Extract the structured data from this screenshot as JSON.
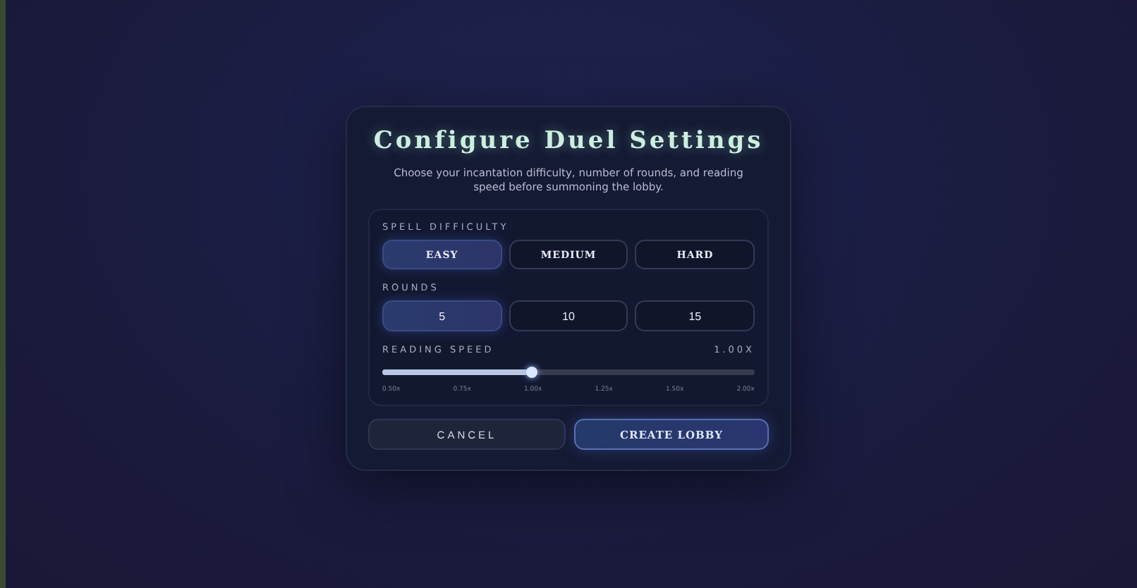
{
  "dialog": {
    "title": "Configure Duel Settings",
    "description": "Choose your incantation difficulty, number of rounds, and reading speed before summoning the lobby."
  },
  "difficulty": {
    "label": "SPELL DIFFICULTY",
    "options": [
      {
        "label": "EASY",
        "selected": true
      },
      {
        "label": "MEDIUM",
        "selected": false
      },
      {
        "label": "HARD",
        "selected": false
      }
    ]
  },
  "rounds": {
    "label": "ROUNDS",
    "options": [
      {
        "label": "5",
        "selected": true
      },
      {
        "label": "10",
        "selected": false
      },
      {
        "label": "15",
        "selected": false
      }
    ]
  },
  "reading_speed": {
    "label": "READING SPEED",
    "reading": "1.00X",
    "level": 0.4,
    "ticks": [
      "0.50x",
      "0.75x",
      "1.00x",
      "1.25x",
      "1.50x",
      "2.00x"
    ]
  },
  "buttons": [
    {
      "label": "CANCEL",
      "kind": "secondary"
    },
    {
      "label": "CREATE LOBBY",
      "kind": "primary"
    }
  ]
}
